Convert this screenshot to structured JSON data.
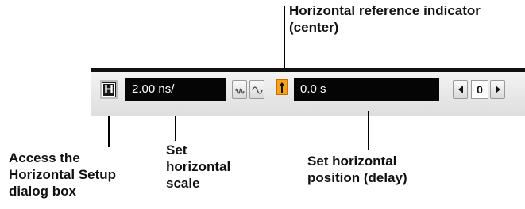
{
  "callouts": {
    "ref_indicator": [
      "Horizontal reference indicator",
      "(center)"
    ],
    "access_setup": [
      "Access the",
      "Horizontal Setup",
      "dialog box"
    ],
    "set_scale": [
      "Set",
      "horizontal",
      "scale"
    ],
    "set_position": [
      "Set horizontal",
      "position (delay)"
    ]
  },
  "toolbar": {
    "setup_button_glyph": "H",
    "scale_value": "2.00 ns/",
    "position_value": "0.0 s",
    "delay_step_value": "0"
  },
  "icons": [
    "horizontal-setup-icon",
    "zoom-waveform-icon",
    "normal-waveform-icon",
    "reference-arrow-icon",
    "left-arrow-icon",
    "right-arrow-icon"
  ],
  "colors": {
    "reference_indicator": "#f7a21b",
    "field_background": "#050505",
    "toolbar_top_border": "#111111"
  }
}
